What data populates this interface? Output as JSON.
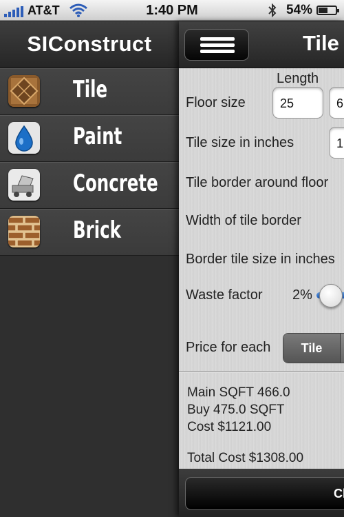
{
  "status_bar": {
    "carrier": "AT&T",
    "time": "1:40 PM",
    "battery_text": "54%",
    "battery_level": 0.54,
    "icons": [
      "signal-bars-icon",
      "wifi-icon",
      "bluetooth-icon",
      "battery-icon"
    ]
  },
  "sidebar": {
    "app_title": "SIConstruct",
    "items": [
      {
        "label": "Tile",
        "icon": "tile-icon"
      },
      {
        "label": "Paint",
        "icon": "paint-drop-icon"
      },
      {
        "label": "Concrete",
        "icon": "concrete-mixer-icon"
      },
      {
        "label": "Brick",
        "icon": "brick-icon"
      }
    ]
  },
  "main": {
    "nav_title": "Tile",
    "menu_icon": "hamburger-menu-icon",
    "column_header": "Length",
    "floor_size": {
      "label": "Floor size",
      "length": "25",
      "width": "6"
    },
    "tile_size": {
      "label": "Tile size in inches",
      "value": "1"
    },
    "tile_border": {
      "label": "Tile border around floor"
    },
    "border_width": {
      "label": "Width of tile border"
    },
    "border_tile_size": {
      "label": "Border tile size in inches"
    },
    "waste_factor": {
      "label": "Waste factor",
      "value": "2%",
      "level": 0.02
    },
    "price_for_each": {
      "label": "Price for each",
      "options": [
        "Tile",
        ""
      ],
      "selected": "Tile"
    },
    "results": {
      "main_sqft": "Main SQFT 466.0",
      "buy": "Buy 475.0 SQFT",
      "cost": "Cost $1121.00",
      "total_cost": "Total Cost $1308.00"
    },
    "bottom_button": "Cl"
  },
  "colors": {
    "sidebar_bg": "#2f2f2f",
    "panel_bg": "#d6d6d6",
    "slider_accent": "#2f6fd0"
  }
}
